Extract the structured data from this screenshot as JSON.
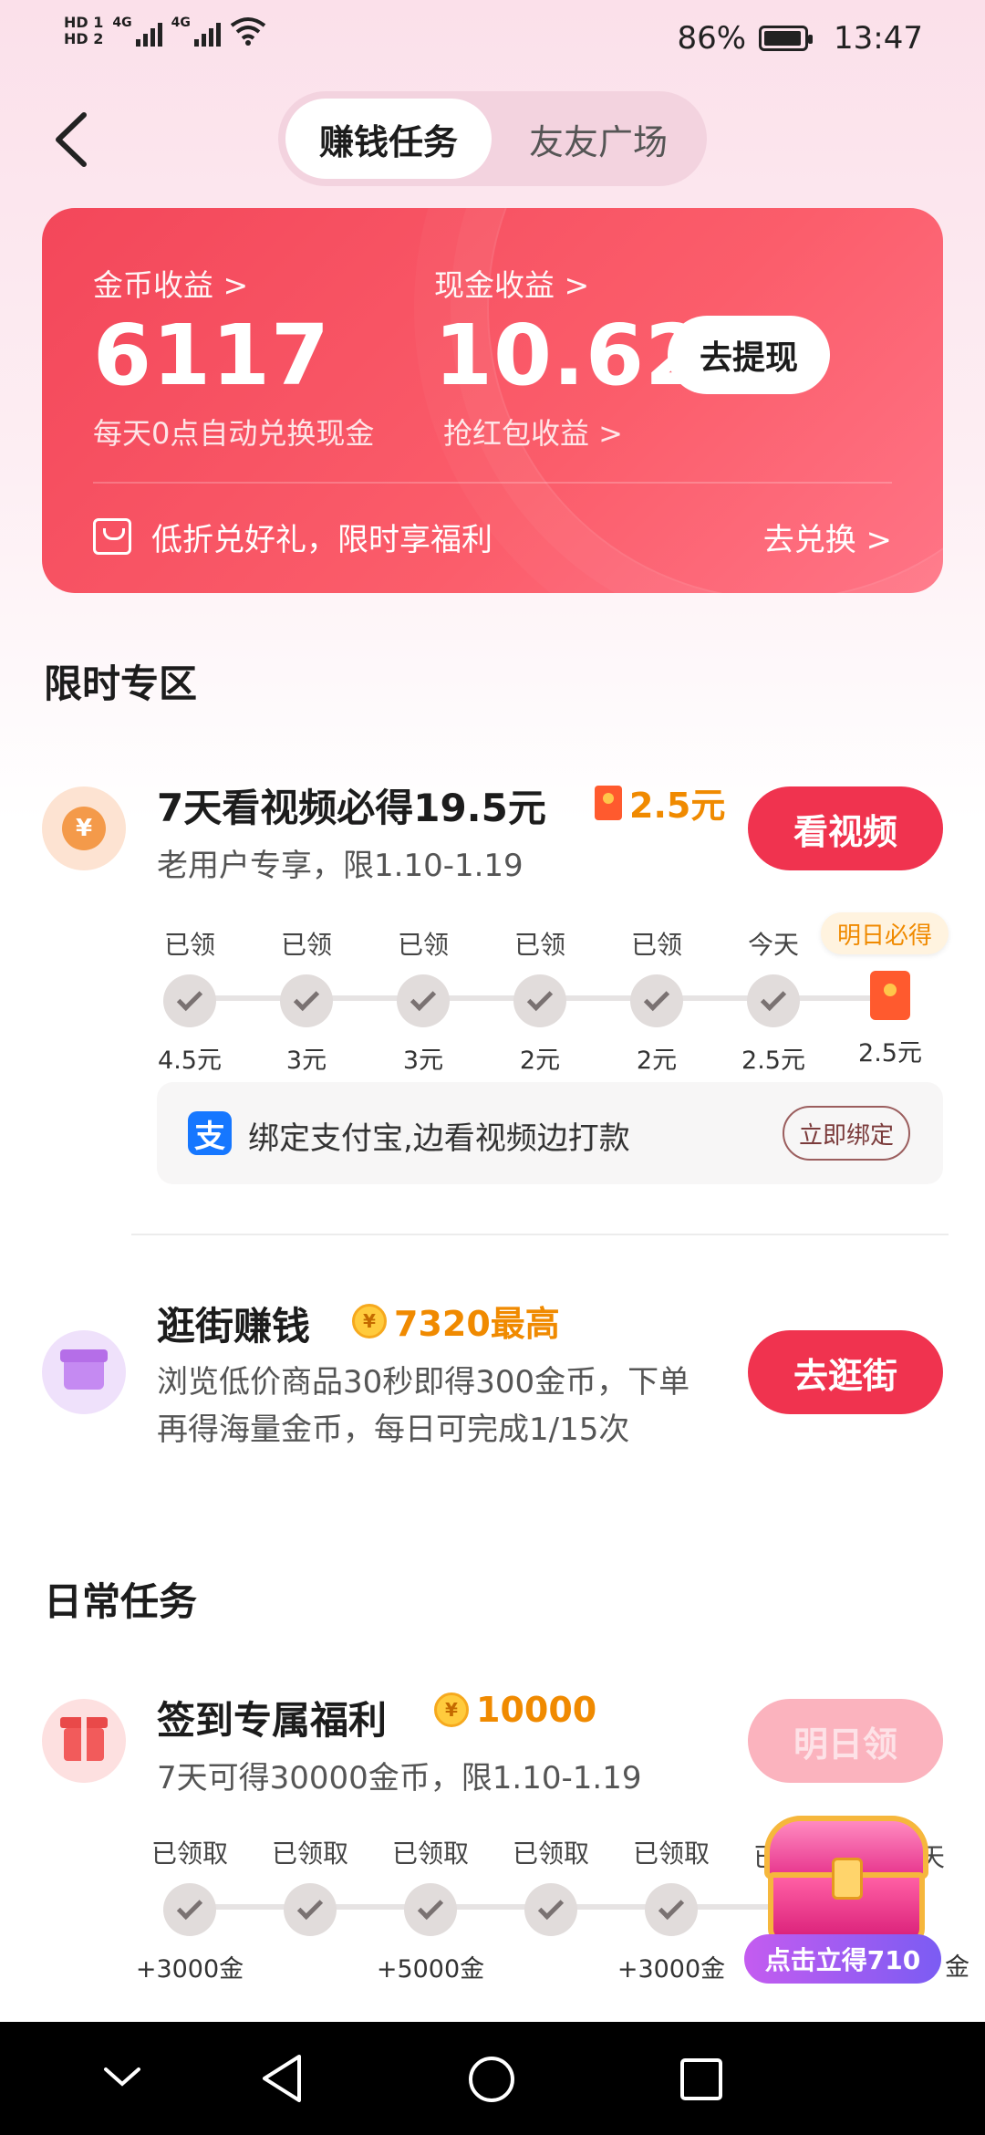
{
  "status_bar": {
    "hd1": "HD 1",
    "hd2": "HD 2",
    "net1": "4G",
    "net2": "4G",
    "battery": "86%",
    "time": "13:47"
  },
  "header": {
    "tabs": [
      "赚钱任务",
      "友友广场"
    ]
  },
  "earnings": {
    "coin_label": "金币收益 >",
    "coin_value": "6117",
    "coin_note": "每天0点自动兑换现金",
    "cash_label": "现金收益 >",
    "cash_value": "10.62",
    "cash_note": "抢红包收益 >",
    "withdraw_label": "去提现",
    "promo_text": "低折兑好礼，限时享福利",
    "redeem_label": "去兑换 >"
  },
  "limited": {
    "title": "限时专区",
    "video_task": {
      "title": "7天看视频必得19.5元",
      "reward": "2.5元",
      "desc": "老用户专享，限1.10-1.19",
      "button": "看视频",
      "badge": "明日必得",
      "steps": [
        {
          "top": "已领",
          "bottom": "4.5元"
        },
        {
          "top": "已领",
          "bottom": "3元"
        },
        {
          "top": "已领",
          "bottom": "3元"
        },
        {
          "top": "已领",
          "bottom": "2元"
        },
        {
          "top": "已领",
          "bottom": "2元"
        },
        {
          "top": "今天",
          "bottom": "2.5元"
        },
        {
          "top": "",
          "bottom": "2.5元"
        }
      ],
      "alipay_text": "绑定支付宝,边看视频边打款",
      "alipay_logo": "支",
      "bind_button": "立即绑定"
    },
    "shop_task": {
      "title": "逛街赚钱",
      "reward": "7320最高",
      "desc_line1": "浏览低价商品30秒即得300金币，下单",
      "desc_line2": "再得海量金币，每日可完成1/15次",
      "button": "去逛街"
    }
  },
  "daily": {
    "title": "日常任务",
    "checkin": {
      "title": "签到专属福利",
      "reward": "10000",
      "desc": "7天可得30000金币，限1.10-1.19",
      "button": "明日领",
      "steps": [
        {
          "top": "已领取",
          "bottom": "+3000金"
        },
        {
          "top": "已领取",
          "bottom": ""
        },
        {
          "top": "已领取",
          "bottom": "+5000金"
        },
        {
          "top": "已领取",
          "bottom": ""
        },
        {
          "top": "已领取",
          "bottom": "+3000金"
        }
      ],
      "partial_top_left": "已",
      "partial_top_right": "天",
      "partial_bottom_right": "金"
    },
    "chest_label": "点击立得710"
  },
  "colors": {
    "accent": "#f0334f",
    "reward": "#f08a00",
    "card_start": "#f3475a",
    "card_end": "#ff7486"
  }
}
